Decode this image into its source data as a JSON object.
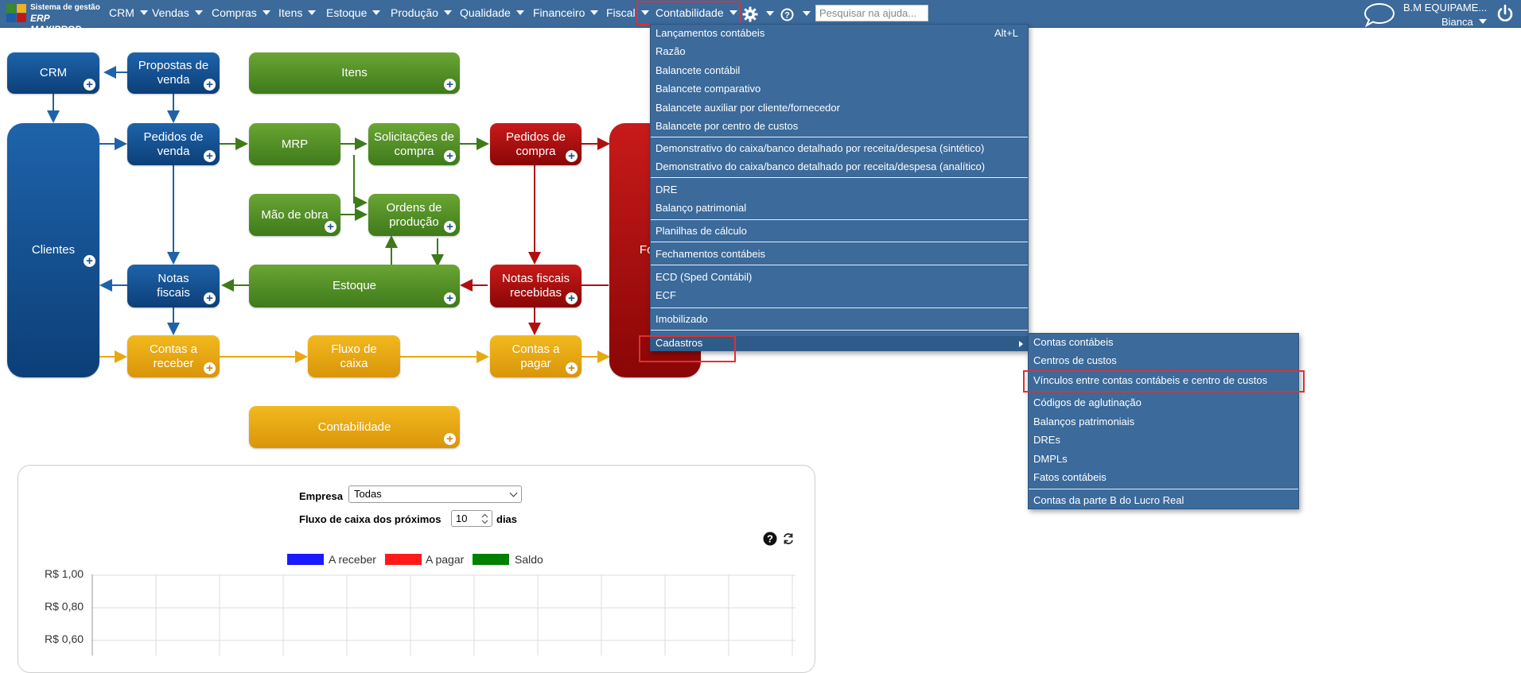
{
  "topbar": {
    "logo_line1": "Sistema de gestão",
    "logo_line2": "ERP MAXIPROD",
    "menus": [
      "CRM",
      "Vendas",
      "Compras",
      "Itens",
      "Estoque",
      "Produção",
      "Qualidade",
      "Financeiro",
      "Fiscal",
      "Contabilidade"
    ],
    "search_placeholder": "Pesquisar na ajuda...",
    "company": "B.M EQUIPAME...",
    "user": "Bianca",
    "icons": [
      "gear-icon",
      "help-icon",
      "chat-icon",
      "power-icon"
    ]
  },
  "flow": {
    "crm": "CRM",
    "propostas": "Propostas de venda",
    "itens": "Itens",
    "clientes": "Clientes",
    "pedidos_venda": "Pedidos de venda",
    "mrp": "MRP",
    "solicitacoes": "Solicitações de compra",
    "pedidos_compra": "Pedidos de compra",
    "fornecedores": "Forne",
    "mao_obra": "Mão de obra",
    "ordens": "Ordens de produção",
    "notas_fiscais": "Notas fiscais",
    "estoque": "Estoque",
    "notas_recebidas": "Notas fiscais recebidas",
    "contas_receber": "Contas a receber",
    "fluxo_caixa": "Fluxo de caixa",
    "contas_pagar": "Contas a pagar",
    "contabilidade": "Contabilidade"
  },
  "dropdown": {
    "items": [
      "Lançamentos contábeis",
      "Razão",
      "Balancete contábil",
      "Balancete comparativo",
      "Balancete auxiliar por cliente/fornecedor",
      "Balancete por centro de custos",
      "Demonstrativo do caixa/banco detalhado por receita/despesa (sintético)",
      "Demonstrativo do caixa/banco detalhado por receita/despesa (analítico)",
      "DRE",
      "Balanço patrimonial",
      "Planilhas de cálculo",
      "Fechamentos contábeis",
      "ECD (Sped Contábil)",
      "ECF",
      "Imobilizado",
      "Cadastros"
    ],
    "shortcut": "Alt+L"
  },
  "submenu": {
    "items": [
      "Contas contábeis",
      "Centros de custos",
      "Vínculos entre contas contábeis e centro de custos",
      "Códigos de aglutinação",
      "Balanços patrimoniais",
      "DREs",
      "DMPLs",
      "Fatos contábeis",
      "Contas da parte B do Lucro Real"
    ]
  },
  "panel": {
    "empresa_label": "Empresa",
    "empresa_value": "Todas",
    "fluxo_label": "Fluxo de caixa dos próximos",
    "days_value": "10",
    "days_label": "dias"
  },
  "chart_data": {
    "type": "line",
    "legend": [
      "A receber",
      "A pagar",
      "Saldo"
    ],
    "colors": [
      "#1a1aff",
      "#ff1a1a",
      "#008000"
    ],
    "y_ticks": [
      "R$ 1,00",
      "R$ 0,80",
      "R$ 0,60"
    ],
    "series": [
      {
        "name": "A receber",
        "values": []
      },
      {
        "name": "A pagar",
        "values": []
      },
      {
        "name": "Saldo",
        "values": []
      }
    ]
  }
}
